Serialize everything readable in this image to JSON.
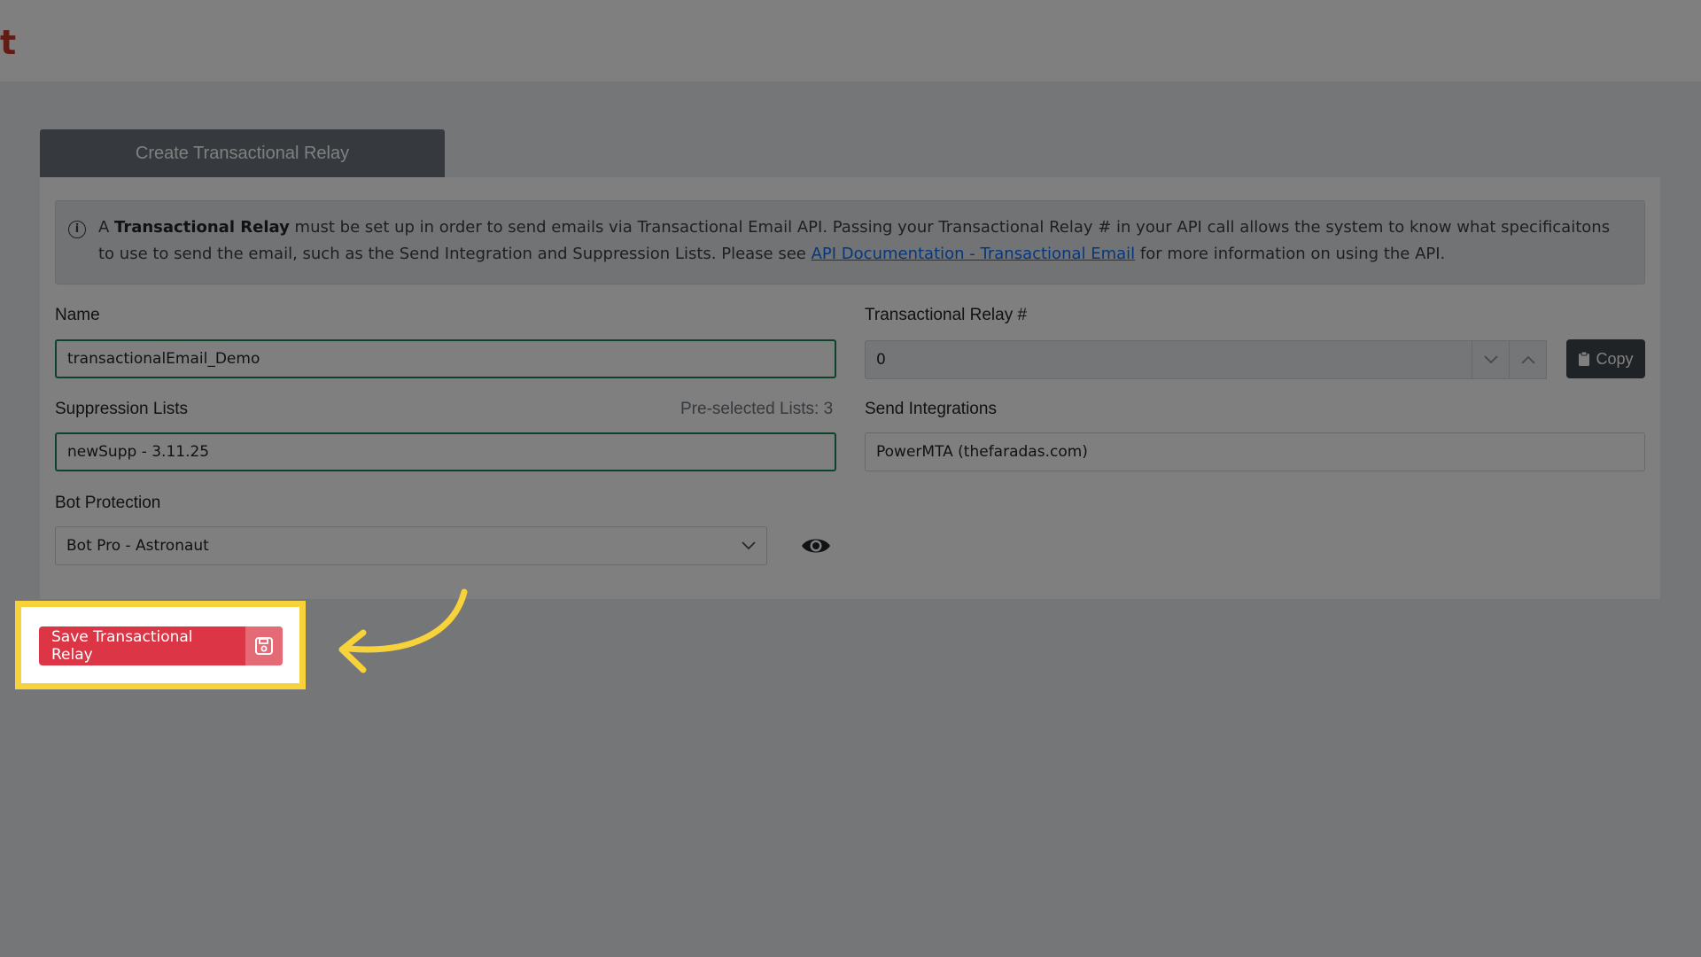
{
  "header": {
    "brand_fragment": "t"
  },
  "tab": {
    "label": "Create Transactional Relay"
  },
  "alert": {
    "prefix": "A ",
    "bold": "Transactional Relay",
    "text1": " must be set up in order to send emails via Transactional Email API. Passing your Transactional Relay # in your API call allows the system to know what specificaitons to use to send the email, such as the Send Integration and Suppression Lists. Please see ",
    "link": "API Documentation - Transactional Email",
    "text2": " for more information on using the API."
  },
  "form": {
    "name_label": "Name",
    "name_value": "transactionalEmail_Demo",
    "relay_label": "Transactional Relay #",
    "relay_value": "0",
    "copy_label": "Copy",
    "suppression_label": "Suppression Lists",
    "preselected_label": "Pre-selected Lists: 3",
    "suppression_value": "newSupp - 3.11.25",
    "integrations_label": "Send Integrations",
    "integrations_value": "PowerMTA (thefaradas.com)",
    "bot_label": "Bot Protection",
    "bot_value": "Bot Pro - Astronaut"
  },
  "save": {
    "label": "Save Transactional Relay"
  },
  "colors": {
    "highlight": "#f7d23a",
    "danger": "#dc3545",
    "valid": "#198754"
  }
}
